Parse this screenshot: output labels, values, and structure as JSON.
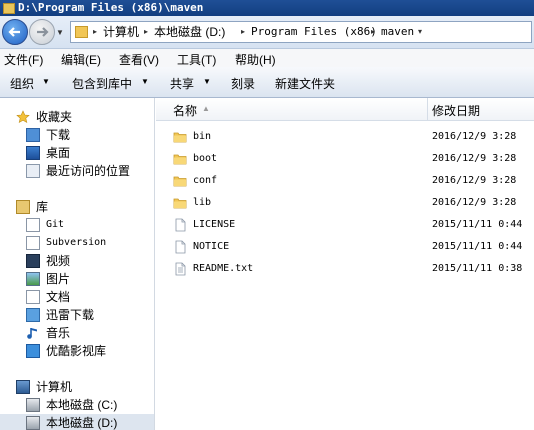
{
  "window": {
    "title": "D:\\Program Files (x86)\\maven"
  },
  "address": {
    "breadcrumbs": [
      "计算机",
      "本地磁盘 (D:)",
      "Program Files (x86)",
      "maven"
    ]
  },
  "menu": [
    "文件(F)",
    "编辑(E)",
    "查看(V)",
    "工具(T)",
    "帮助(H)"
  ],
  "toolbar": {
    "organize": "组织",
    "include_library": "包含到库中",
    "share": "共享",
    "burn": "刻录",
    "new_folder": "新建文件夹"
  },
  "nav": {
    "favorites": {
      "label": "收藏夹",
      "items": [
        "下载",
        "桌面",
        "最近访问的位置"
      ]
    },
    "libraries": {
      "label": "库",
      "items": [
        "Git",
        "Subversion",
        "视频",
        "图片",
        "文档",
        "迅雷下载",
        "音乐",
        "优酷影视库"
      ]
    },
    "computer": {
      "label": "计算机",
      "items": [
        "本地磁盘 (C:)",
        "本地磁盘 (D:)"
      ]
    }
  },
  "columns": {
    "name": "名称",
    "date": "修改日期"
  },
  "files": [
    {
      "name": "bin",
      "date": "2016/12/9 3:28",
      "type": "folder"
    },
    {
      "name": "boot",
      "date": "2016/12/9 3:28",
      "type": "folder"
    },
    {
      "name": "conf",
      "date": "2016/12/9 3:28",
      "type": "folder"
    },
    {
      "name": "lib",
      "date": "2016/12/9 3:28",
      "type": "folder"
    },
    {
      "name": "LICENSE",
      "date": "2015/11/11 0:44",
      "type": "file"
    },
    {
      "name": "NOTICE",
      "date": "2015/11/11 0:44",
      "type": "file"
    },
    {
      "name": "README.txt",
      "date": "2015/11/11 0:38",
      "type": "textfile"
    }
  ],
  "colors": {
    "titlebar": "#1f4f96",
    "folder": "#f1c656",
    "selection": "#dde5ef"
  }
}
